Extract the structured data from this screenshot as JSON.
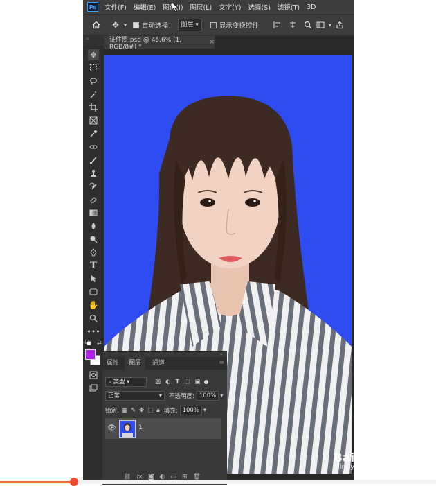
{
  "app": {
    "logo": "Ps",
    "menu": [
      "文件(F)",
      "编辑(E)",
      "图像(I)",
      "图层(L)",
      "文字(Y)",
      "选择(S)",
      "滤镜(T)",
      "3D"
    ]
  },
  "options": {
    "auto_select_label": "自动选择：",
    "auto_select_target": "图层",
    "show_transform_label": "显示变换控件"
  },
  "document": {
    "tab_title": "证件照.psd @ 45.6% (1, RGB/8#) *",
    "close": "×"
  },
  "colors": {
    "background_blue": "#2f4cf2",
    "foreground_swatch": "#b01fe8",
    "background_swatch": "#ffffff",
    "accent_orange": "#f47036"
  },
  "layers_panel": {
    "tabs": [
      "属性",
      "图层",
      "通道"
    ],
    "active_tab": "图层",
    "filter_label": "类型",
    "blend_mode": "正常",
    "opacity_label": "不透明度:",
    "opacity_value": "100%",
    "lock_label": "锁定:",
    "fill_label": "填充:",
    "fill_value": "100%",
    "layers": [
      {
        "name": "1",
        "visible": true
      }
    ],
    "bottom_icons": [
      "link-icon",
      "fx-icon",
      "mask-icon",
      "adjustment-icon",
      "folder-icon",
      "new-layer-icon",
      "trash-icon"
    ]
  },
  "tools": [
    "move",
    "marquee",
    "lasso",
    "magic-wand",
    "crop",
    "frame",
    "eyedropper",
    "healing",
    "brush",
    "stamp",
    "history-brush",
    "eraser",
    "gradient",
    "blur",
    "dodge",
    "pen",
    "type",
    "path-select",
    "shape",
    "hand",
    "zoom",
    "more"
  ],
  "overlay": {
    "next_icon": "chevron-right-icon",
    "watermark_text": "Bai du 经验",
    "watermark_url": "jingyan.baidu.com",
    "progress": 0.17
  }
}
